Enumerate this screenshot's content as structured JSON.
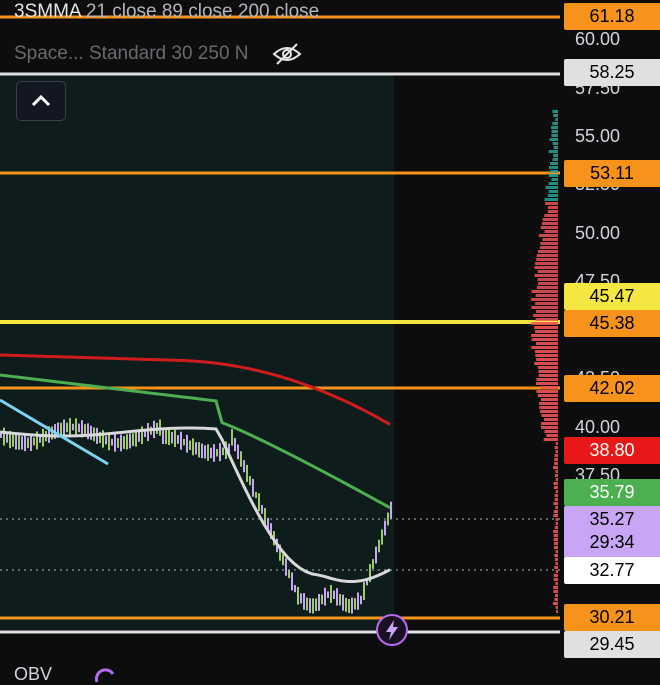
{
  "legend": {
    "line1_name": "3SMMA",
    "line1_params": "21 close 89 close 200 close",
    "line2_name": "Space...",
    "line2_params": "Standard 30 250 N"
  },
  "icons": {
    "visibility_toggle": "eye-off-icon",
    "collapse": "chevron-up-icon",
    "alert": "lightning-icon",
    "refresh": "refresh-icon"
  },
  "axis_ticks": [
    "60.00",
    "57.50",
    "55.00",
    "52.50",
    "50.00",
    "47.50",
    "42.50",
    "40.00",
    "37.50"
  ],
  "price_tags": [
    {
      "id": "tag-61-18",
      "text": "61.18",
      "bg": "#f7931a",
      "fg": "#000000"
    },
    {
      "id": "tag-58-25",
      "text": "58.25",
      "bg": "#e0e0e0",
      "fg": "#000000"
    },
    {
      "id": "tag-53-11",
      "text": "53.11",
      "bg": "#f7931a",
      "fg": "#000000"
    },
    {
      "id": "tag-45-47",
      "text": "45.47",
      "bg": "#f5e642",
      "fg": "#000000"
    },
    {
      "id": "tag-45-38",
      "text": "45.38",
      "bg": "#f7931a",
      "fg": "#000000"
    },
    {
      "id": "tag-42-02",
      "text": "42.02",
      "bg": "#f7931a",
      "fg": "#000000"
    },
    {
      "id": "tag-38-80",
      "text": "38.80",
      "bg": "#e81818",
      "fg": "#ffffff"
    },
    {
      "id": "tag-35-79",
      "text": "35.79",
      "bg": "#4caf50",
      "fg": "#ffffff"
    },
    {
      "id": "tag-35-27",
      "text": "35.27",
      "sub": "29:34",
      "bg": "#c9a6f5",
      "fg": "#000000"
    },
    {
      "id": "tag-32-77",
      "text": "32.77",
      "bg": "#ffffff",
      "fg": "#000000"
    },
    {
      "id": "tag-30-21",
      "text": "30.21",
      "bg": "#f7931a",
      "fg": "#000000"
    },
    {
      "id": "tag-29-45",
      "text": "29.45",
      "bg": "#e0e0e0",
      "fg": "#000000"
    }
  ],
  "colors": {
    "background": "#0d0d0d",
    "highlight_region": "#0e1c1c",
    "ma21": "#d8d8d8",
    "ma89": "#4caf50",
    "ma200": "#d01c1c",
    "level_orange": "#f7931a",
    "level_yellow": "#f5e642",
    "trendline": "#7dd3f0",
    "candle_up": "#9ccc65",
    "candle_down": "#c9a6f5",
    "volume_up": "#26a69a",
    "volume_down": "#ef5350"
  },
  "footer": {
    "indicator": "OBV"
  }
}
